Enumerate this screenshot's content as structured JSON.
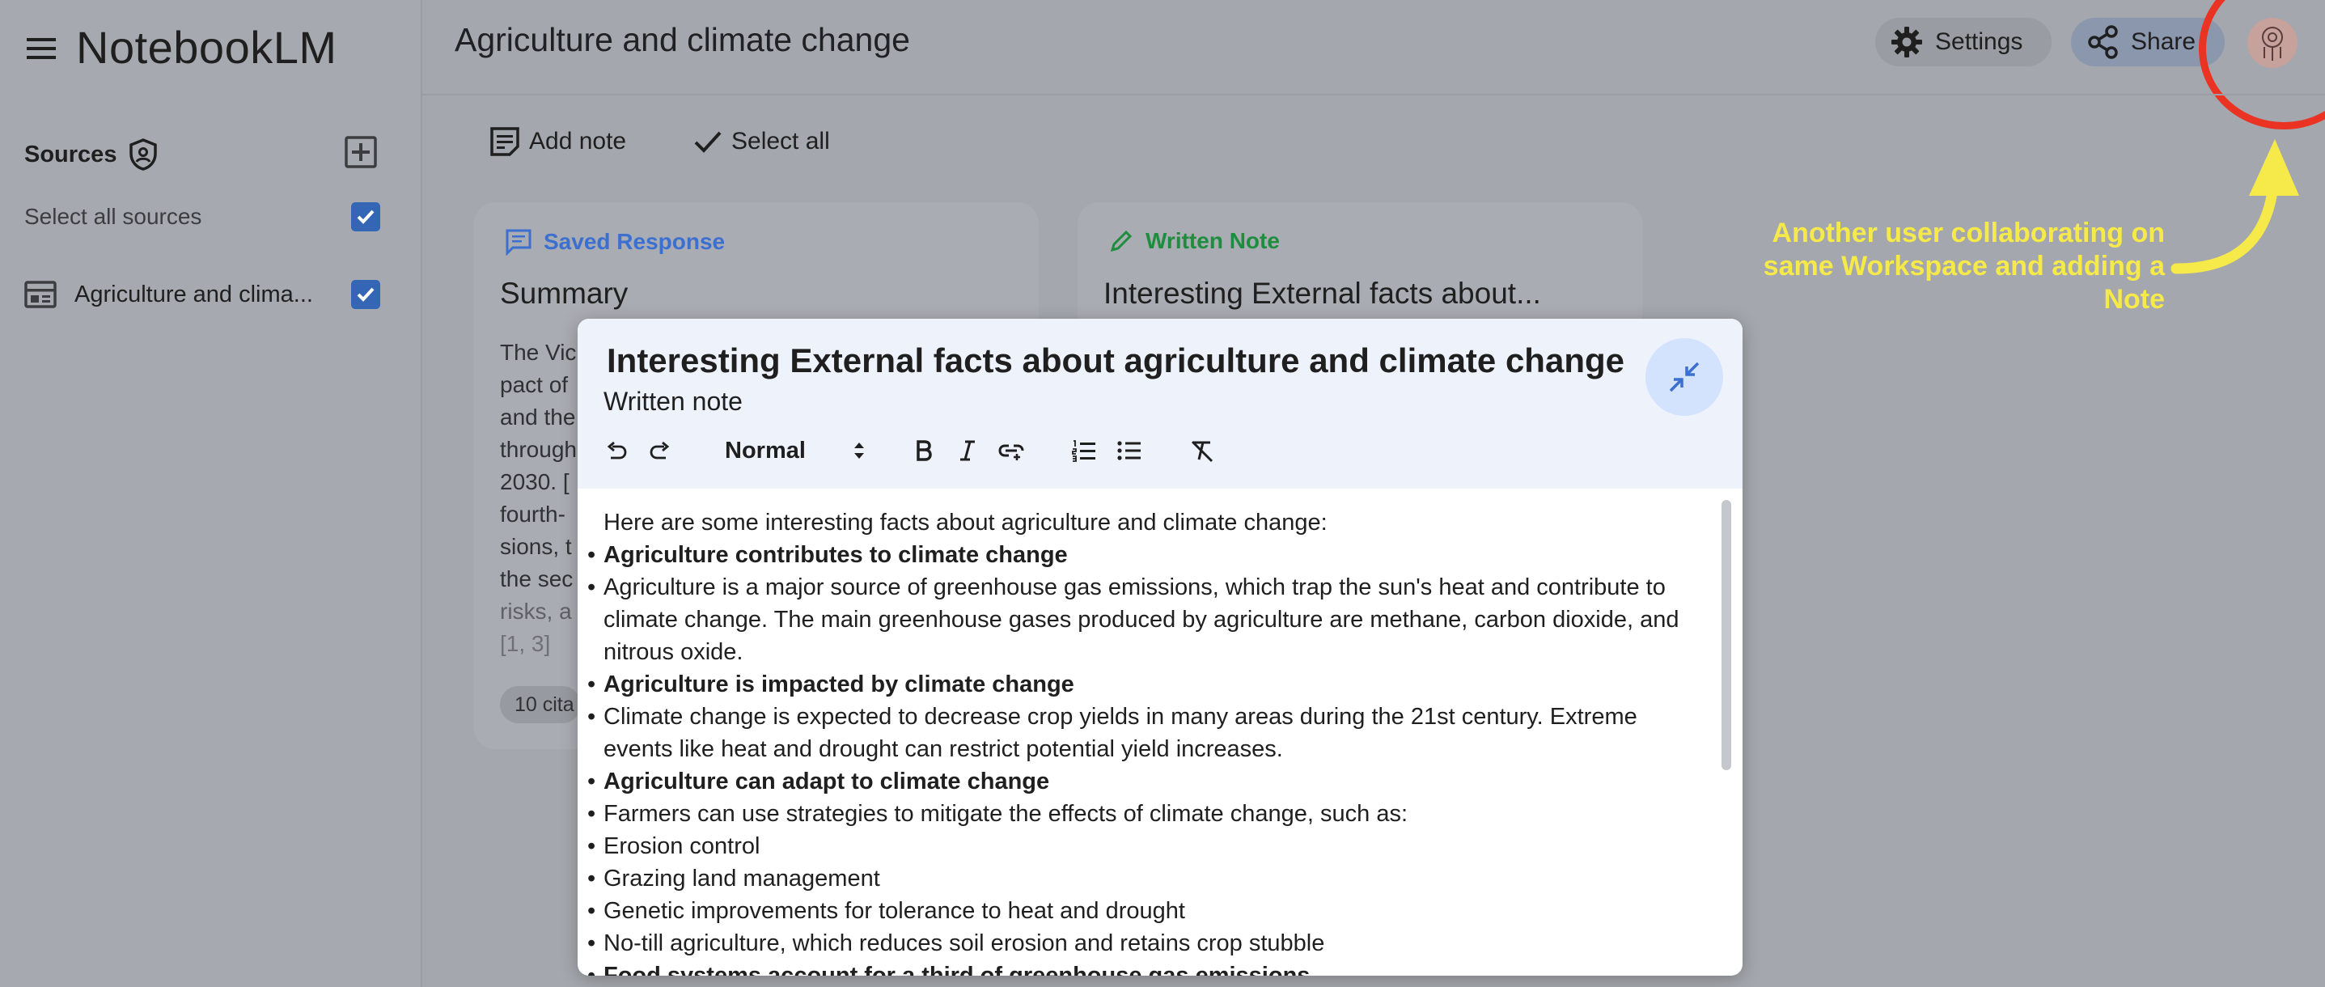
{
  "app": {
    "name": "NotebookLM"
  },
  "sidebar": {
    "sources_label": "Sources",
    "select_all_label": "Select all sources",
    "sources": [
      {
        "label": "Agriculture and clima..."
      }
    ]
  },
  "header": {
    "notebook_title": "Agriculture and climate change",
    "settings_label": "Settings",
    "share_label": "Share"
  },
  "toolbar": {
    "add_note": "Add note",
    "select_all": "Select all"
  },
  "cards": [
    {
      "type_label": "Saved Response",
      "title": "Summary",
      "body_lines": [
        "The Vic",
        "pact of",
        "and the",
        "through",
        "2030. [",
        "fourth-",
        "sions, t",
        "the sec",
        "risks, a",
        "[1, 3]"
      ],
      "citations": "10 cita"
    },
    {
      "type_label": "Written Note",
      "title": "Interesting External facts about..."
    }
  ],
  "annotation": {
    "text": "Another user collaborating on same Workspace and adding a Note"
  },
  "dialog": {
    "title": "Interesting External facts about agriculture and climate change",
    "subtitle": "Written note",
    "format_select": "Normal",
    "intro": "Here are some interesting facts about agriculture and climate change:",
    "items": [
      {
        "heading": "Agriculture contributes to climate change",
        "text": "Agriculture is a major source of greenhouse gas emissions, which trap the sun's heat and contribute to climate change. The main greenhouse gases produced by agriculture are methane, carbon dioxide, and nitrous oxide."
      },
      {
        "heading": "Agriculture is impacted by climate change",
        "text": "Climate change is expected to decrease crop yields in many areas during the 21st century. Extreme events like heat and drought can restrict potential yield increases."
      },
      {
        "heading": "Agriculture can adapt to climate change",
        "text": "Farmers can use strategies to mitigate the effects of climate change, such as:",
        "sub": [
          "Erosion control",
          "Grazing land management",
          "Genetic improvements for tolerance to heat and drought",
          "No-till agriculture, which reduces soil erosion and retains crop stubble"
        ]
      },
      {
        "heading": "Food systems account for a third of greenhouse gas emissions"
      }
    ]
  },
  "colors": {
    "saved_response": "#3b6fd0",
    "written_note": "#1e8e3e",
    "checkbox": "#3566b6",
    "highlight_circle": "#ea3323",
    "annotation": "#f6e94a"
  }
}
